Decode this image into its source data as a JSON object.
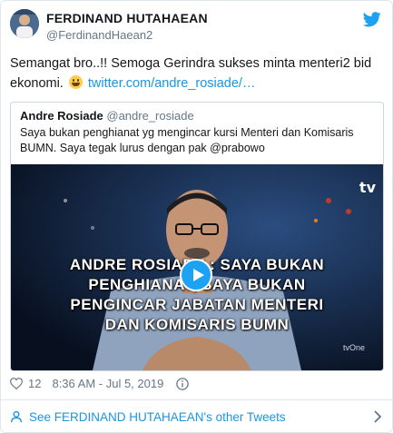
{
  "author": {
    "name": "FERDINAND HUTAHAEAN",
    "handle": "@FerdinandHaean2",
    "avatar_icon": "avatar"
  },
  "brand_icon": "twitter-bird-icon",
  "tweet": {
    "text": "Semangat bro..!! Semoga Gerindra sukses minta menteri2 bid ekonomi.",
    "emoji_icon": "grinning-face-icon",
    "link_text": "twitter.com/andre_rosiade/…"
  },
  "quoted": {
    "name": "Andre Rosiade",
    "handle": "@andre_rosiade",
    "text": "Saya bukan penghianat yg mengincar kursi Menteri dan Komisaris BUMN. Saya tegak lurus dengan pak @prabowo",
    "video": {
      "caption_lines": [
        "ANDRE ROSIADE : SAYA BUKAN",
        "PENGHIANAT, SAYA BUKAN",
        "PENGINCAR JABATAN MENTERI",
        "DAN KOMISARIS BUMN"
      ],
      "channel_logo": "tv",
      "watermark": "tvOne",
      "play_icon": "play-icon"
    }
  },
  "meta": {
    "likes": "12",
    "timestamp": "8:36 AM - Jul 5, 2019",
    "heart_icon": "heart-icon",
    "info_icon": "info-icon"
  },
  "footer": {
    "label": "See FERDINAND HUTAHAEAN's other Tweets",
    "user_icon": "user-icon",
    "chevron_icon": "chevron-right-icon"
  },
  "colors": {
    "link": "#1b95e0",
    "twitter_blue": "#1da1f2",
    "secondary_text": "#657786",
    "border": "#e1e8ed"
  }
}
